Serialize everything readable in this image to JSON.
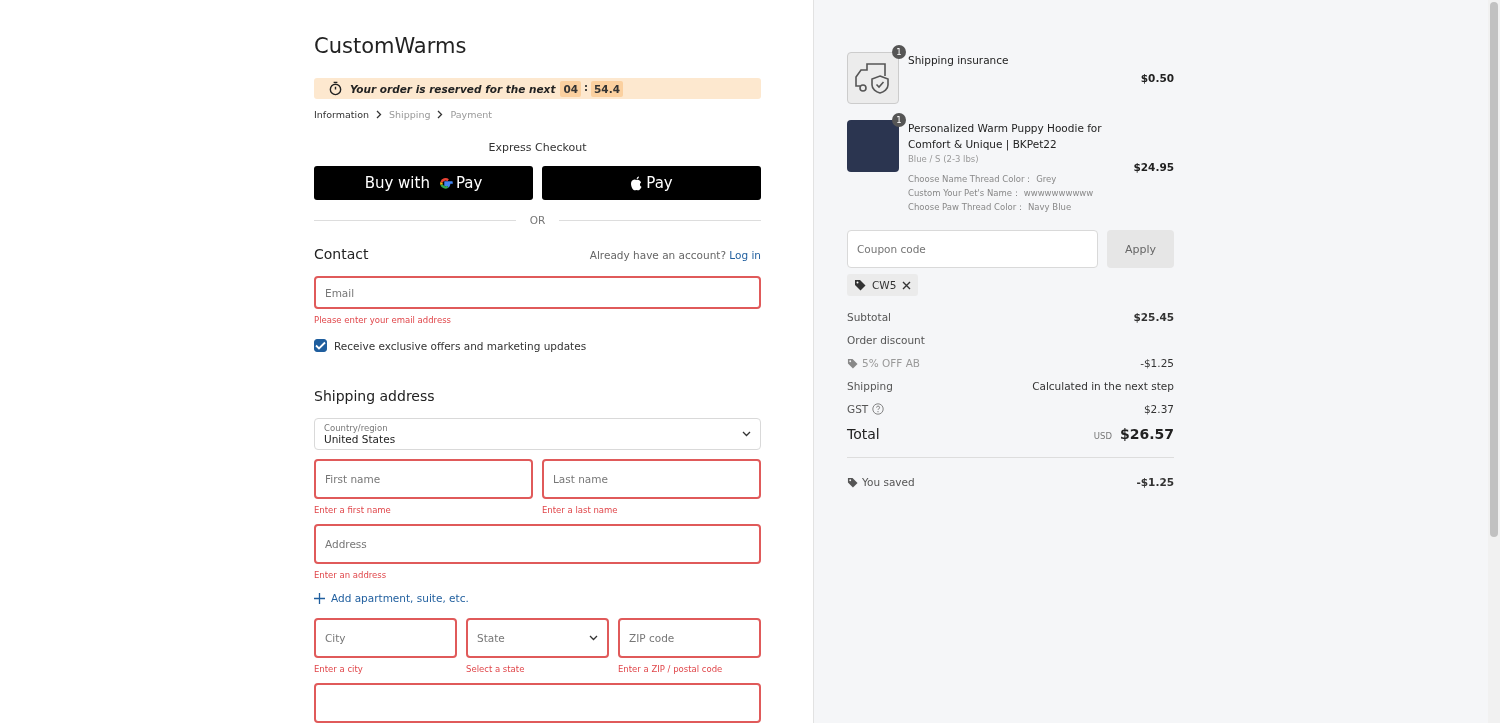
{
  "store": {
    "name": "CustomWarms"
  },
  "reservation": {
    "text": "Your order is reserved for the next",
    "minutes": "04",
    "separator": ":",
    "seconds": "54.4"
  },
  "breadcrumb": [
    {
      "label": "Information",
      "selected": true
    },
    {
      "label": "Shipping",
      "selected": false
    },
    {
      "label": "Payment",
      "selected": false
    }
  ],
  "express_checkout": {
    "title": "Express Checkout",
    "buttons": [
      {
        "kind": "gpay",
        "prefix": "Buy with",
        "label": "Pay"
      },
      {
        "kind": "applepay",
        "label": "Pay"
      }
    ],
    "divider": "OR"
  },
  "contact": {
    "title": "Contact",
    "account_prompt": "Already have an account?",
    "login_link": "Log in",
    "email": {
      "placeholder": "Email",
      "error": "Please enter your email address"
    },
    "marketing": {
      "label": "Receive exclusive offers and marketing updates",
      "checked": true
    }
  },
  "shipping_address": {
    "title": "Shipping address",
    "country": {
      "label": "Country/region",
      "value": "United States"
    },
    "rows": [
      [
        {
          "kind": "input",
          "placeholder": "First name",
          "error": "Enter a first name"
        },
        {
          "kind": "input",
          "placeholder": "Last name",
          "error": "Enter a last name"
        }
      ],
      [
        {
          "kind": "input",
          "placeholder": "Address",
          "error": "Enter an address"
        }
      ],
      [
        {
          "kind": "link",
          "label": "Add apartment, suite, etc."
        }
      ],
      [
        {
          "kind": "input",
          "placeholder": "City",
          "error": "Enter a city"
        },
        {
          "kind": "select",
          "placeholder": "State",
          "error": "Select a state"
        },
        {
          "kind": "input",
          "placeholder": "ZIP code",
          "error": "Enter a ZIP / postal code"
        }
      ],
      [
        {
          "kind": "input"
        }
      ]
    ]
  },
  "order_summary": {
    "items": [
      {
        "kind": "insurance",
        "quantity": "1",
        "title": "Shipping insurance",
        "price": "$0.50"
      },
      {
        "kind": "product",
        "quantity": "1",
        "title": "Personalized Warm Puppy Hoodie for Comfort & Unique | BKPet22",
        "variant": "Blue / S (2-3 lbs)",
        "price": "$24.95",
        "options": [
          {
            "name": "Choose Name Thread Color：",
            "value": "Grey"
          },
          {
            "name": "Custom Your Pet's Name：",
            "value": "wwwwwwwwww"
          },
          {
            "name": "Choose Paw Thread Color：",
            "value": "Navy Blue"
          }
        ]
      }
    ],
    "coupon": {
      "placeholder": "Coupon code",
      "button": "Apply",
      "applied": [
        "CW5"
      ]
    },
    "lines": [
      {
        "kind": "subtotal",
        "label": "Subtotal",
        "value": "$25.45"
      },
      {
        "kind": "heading",
        "label": "Order discount"
      },
      {
        "kind": "discount",
        "label": "5% OFF AB",
        "value": "-$1.25"
      },
      {
        "kind": "muted",
        "label": "Shipping",
        "value": "Calculated in the next step"
      },
      {
        "kind": "tax",
        "label": "GST",
        "value": "$2.37"
      },
      {
        "kind": "total",
        "label": "Total",
        "currency": "USD",
        "value": "$26.57"
      }
    ],
    "savings": {
      "label": "You saved",
      "value": "-$1.25"
    }
  }
}
